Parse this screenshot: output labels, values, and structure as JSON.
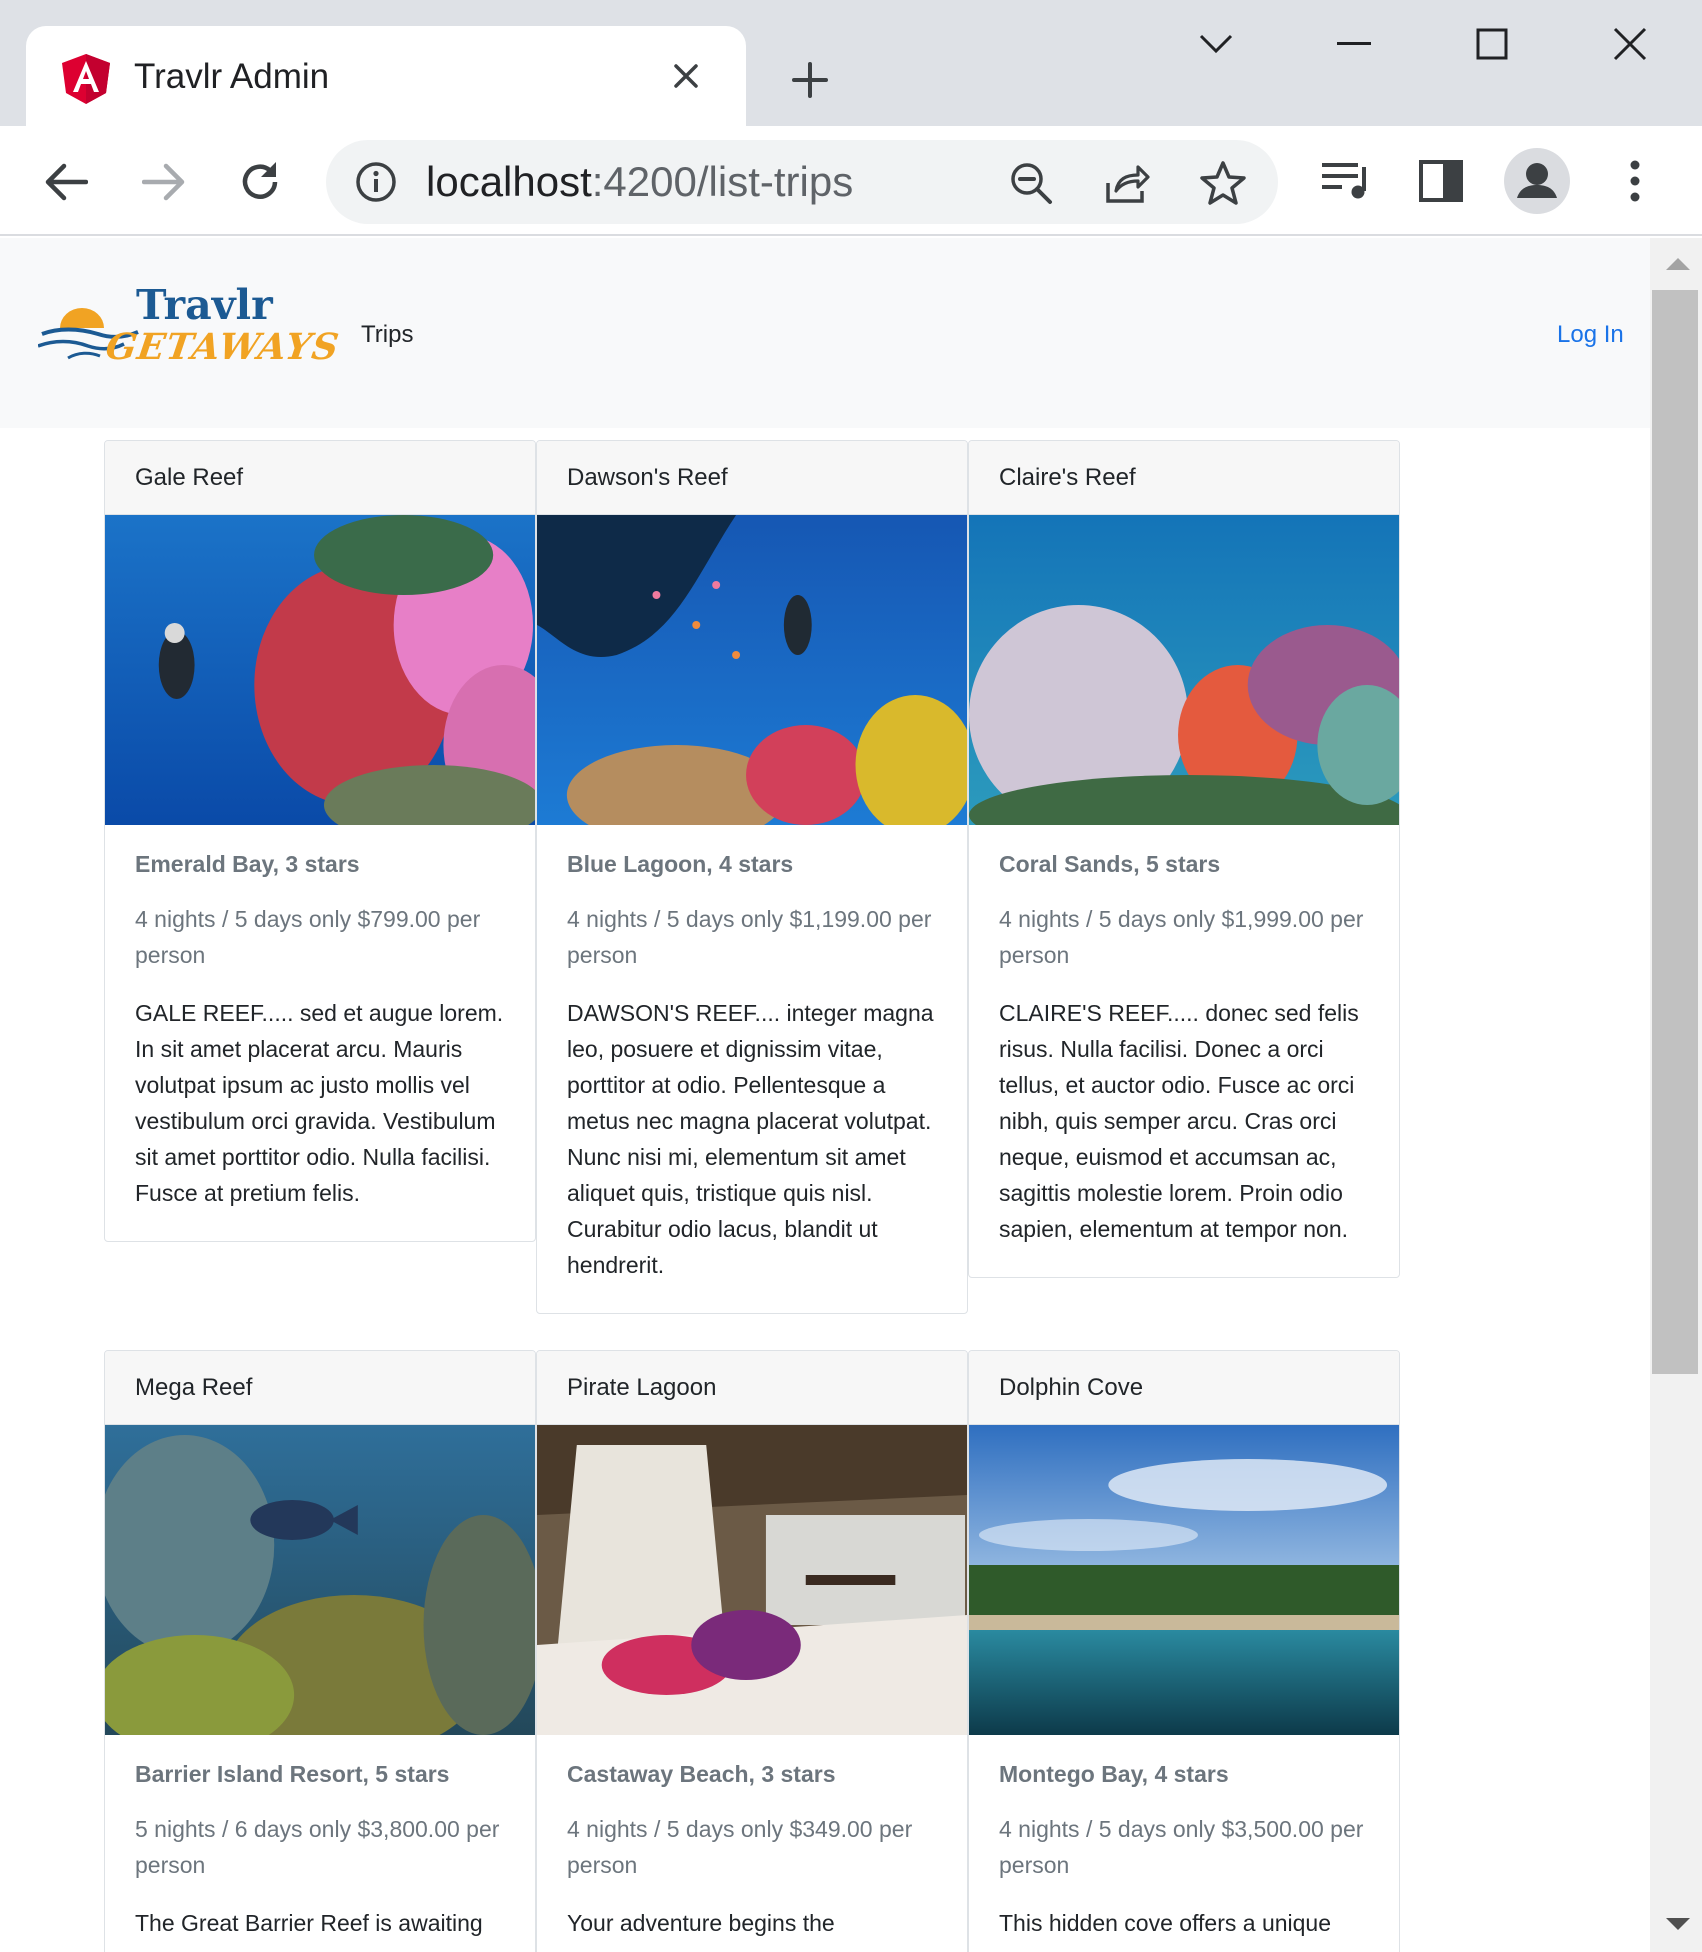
{
  "browser": {
    "tab_title": "Travlr Admin",
    "url_host": "localhost",
    "url_rest": ":4200/list-trips"
  },
  "navbar": {
    "brand_line1": "Travlr",
    "brand_line2": "GETAWAYS",
    "trips_link": "Trips",
    "login_link": "Log In"
  },
  "trips": [
    {
      "name": "Gale Reef",
      "resort": "Emerald Bay, 3 stars",
      "price": "4 nights / 5 days only $799.00 per person",
      "description": "GALE REEF..... sed et augue lorem. In sit amet placerat arcu. Mauris volutpat ipsum ac justo mollis vel vestibulum orci gravida. Vestibulum sit amet porttitor odio. Nulla facilisi. Fusce at pretium felis."
    },
    {
      "name": "Dawson's Reef",
      "resort": "Blue Lagoon, 4 stars",
      "price": "4 nights / 5 days only $1,199.00 per person",
      "description": "DAWSON'S REEF.... integer magna leo, posuere et dignissim vitae, porttitor at odio. Pellentesque a metus nec magna placerat volutpat. Nunc nisi mi, elementum sit amet aliquet quis, tristique quis nisl. Curabitur odio lacus, blandit ut hendrerit."
    },
    {
      "name": "Claire's Reef",
      "resort": "Coral Sands, 5 stars",
      "price": "4 nights / 5 days only $1,999.00 per person",
      "description": "CLAIRE'S REEF..... donec sed felis risus. Nulla facilisi. Donec a orci tellus, et auctor odio. Fusce ac orci nibh, quis semper arcu. Cras orci neque, euismod et accumsan ac, sagittis molestie lorem. Proin odio sapien, elementum at tempor non."
    },
    {
      "name": "Mega Reef",
      "resort": "Barrier Island Resort, 5 stars",
      "price": "5 nights / 6 days only $3,800.00 per person",
      "description": "The Great Barrier Reef is awaiting"
    },
    {
      "name": "Pirate Lagoon",
      "resort": "Castaway Beach, 3 stars",
      "price": "4 nights / 5 days only $349.00 per person",
      "description": "Your adventure begins the"
    },
    {
      "name": "Dolphin Cove",
      "resort": "Montego Bay, 4 stars",
      "price": "4 nights / 5 days only $3,500.00 per person",
      "description": "This hidden cove offers a unique"
    }
  ],
  "colors": {
    "link": "#1a73e8",
    "navbar_bg": "#f8f9fa",
    "brand_blue": "#1c5a93",
    "brand_orange": "#f1a323",
    "muted_text": "#6c757d"
  }
}
